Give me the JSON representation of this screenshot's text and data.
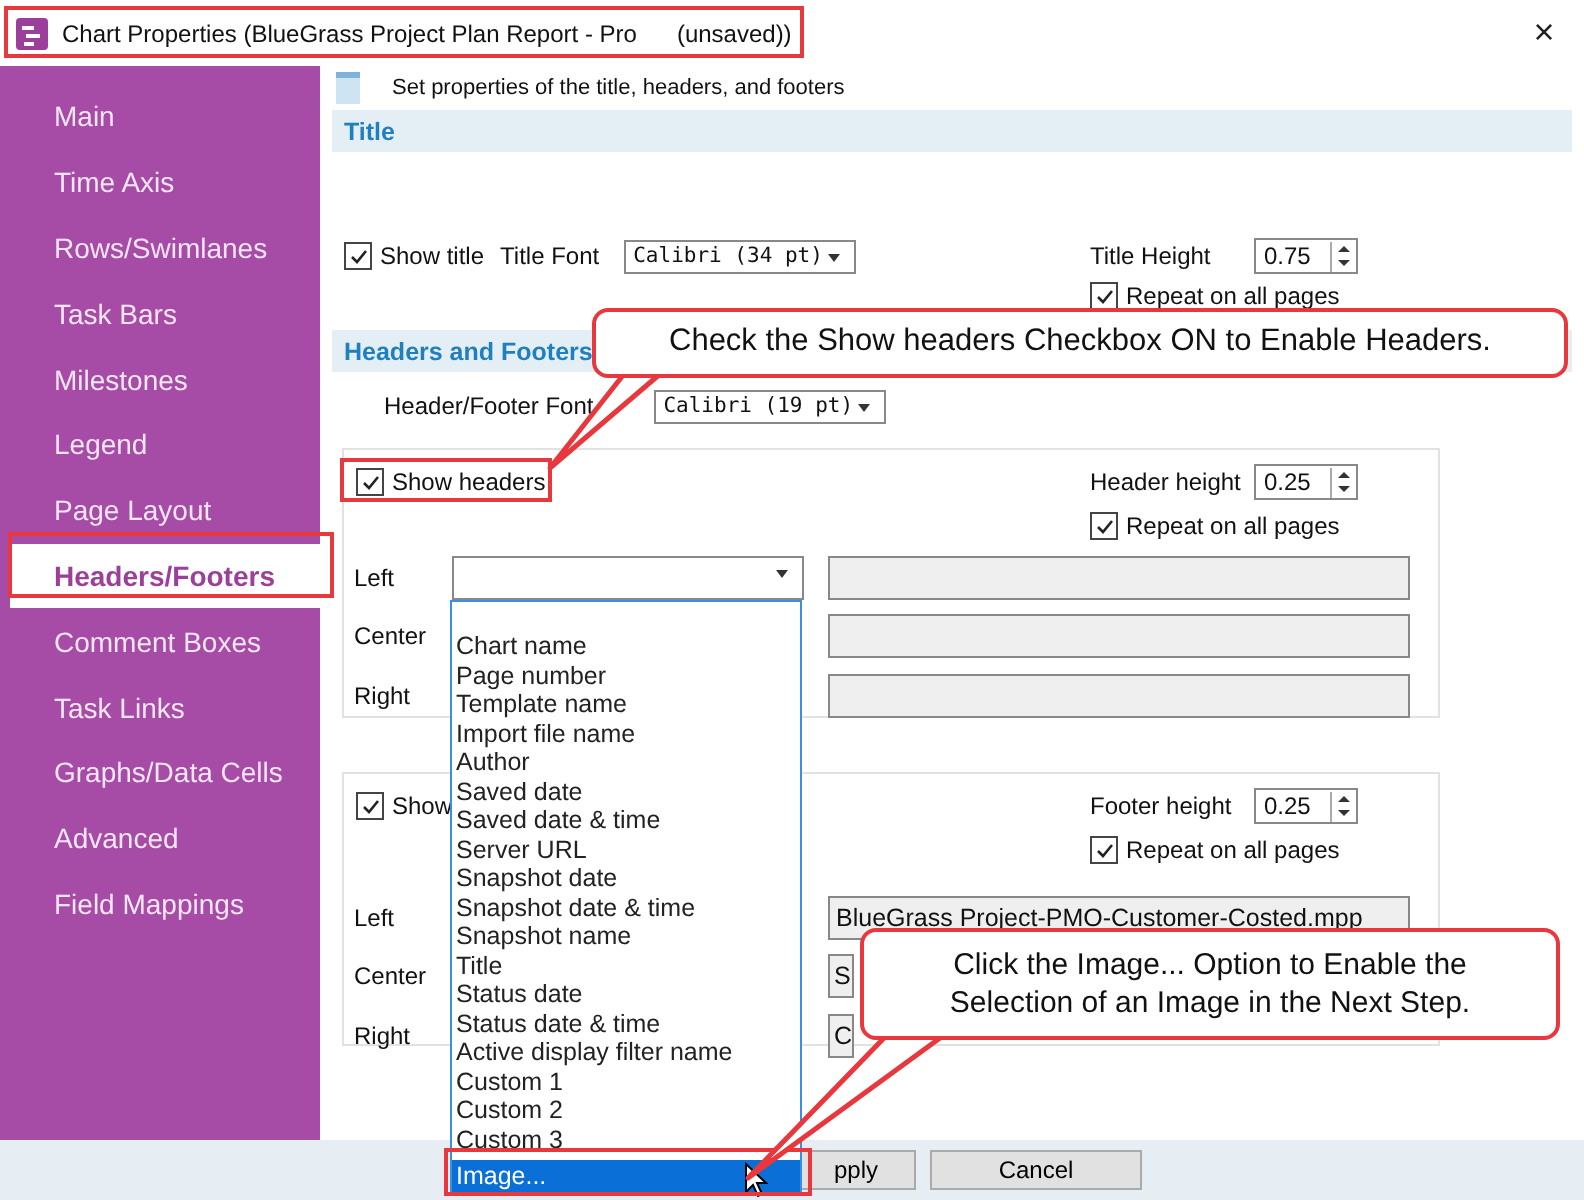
{
  "window": {
    "title": "Chart Properties (BlueGrass Project Plan Report - Pro      (unsaved))",
    "close": "×"
  },
  "sidebar": {
    "items": [
      {
        "label": "Main",
        "selected": false
      },
      {
        "label": "Time Axis",
        "selected": false
      },
      {
        "label": "Rows/Swimlanes",
        "selected": false
      },
      {
        "label": "Task Bars",
        "selected": false
      },
      {
        "label": "Milestones",
        "selected": false
      },
      {
        "label": "Legend",
        "selected": false
      },
      {
        "label": "Page Layout",
        "selected": false
      },
      {
        "label": "Headers/Footers",
        "selected": true
      },
      {
        "label": "Comment Boxes",
        "selected": false
      },
      {
        "label": "Task Links",
        "selected": false
      },
      {
        "label": "Graphs/Data Cells",
        "selected": false
      },
      {
        "label": "Advanced",
        "selected": false
      },
      {
        "label": "Field Mappings",
        "selected": false
      }
    ]
  },
  "page_header": "Set properties of the title, headers, and footers",
  "title_section": {
    "heading": "Title",
    "show_title": {
      "label": "Show title",
      "checked": true
    },
    "font_label": "Title Font",
    "font_value": "Calibri (34 pt)",
    "height_label": "Title Height",
    "height_value": "0.75",
    "repeat": {
      "label": "Repeat on all pages",
      "checked": true
    }
  },
  "headers_footers": {
    "heading": "Headers and Footers",
    "font_label": "Header/Footer Font",
    "font_value": "Calibri (19 pt)",
    "headers": {
      "checkbox": {
        "label": "Show headers",
        "checked": true
      },
      "height_label": "Header height",
      "height_value": "0.25",
      "repeat": {
        "label": "Repeat on all pages",
        "checked": true
      },
      "rows": [
        {
          "label": "Left",
          "dropdown": true,
          "value": ""
        },
        {
          "label": "Center",
          "dropdown": false,
          "value": ""
        },
        {
          "label": "Right",
          "dropdown": false,
          "value": ""
        }
      ]
    },
    "footers": {
      "checkbox": {
        "label": "Show",
        "checked": true
      },
      "height_label": "Footer height",
      "height_value": "0.25",
      "repeat": {
        "label": "Repeat on all pages",
        "checked": true
      },
      "rows": [
        {
          "label": "Left",
          "dropdown": false,
          "value": "BlueGrass Project-PMO-Customer-Costed.mpp"
        },
        {
          "label": "Center",
          "dropdown": false,
          "value": "S"
        },
        {
          "label": "Right",
          "dropdown": false,
          "value": "C"
        }
      ]
    }
  },
  "dropdown_list": {
    "items": [
      {
        "label": "Chart name",
        "selected": false
      },
      {
        "label": "Page number",
        "selected": false
      },
      {
        "label": "Template name",
        "selected": false
      },
      {
        "label": "Import file name",
        "selected": false
      },
      {
        "label": "Author",
        "selected": false
      },
      {
        "label": "Saved date",
        "selected": false
      },
      {
        "label": "Saved date & time",
        "selected": false
      },
      {
        "label": "Server URL",
        "selected": false
      },
      {
        "label": "Snapshot date",
        "selected": false
      },
      {
        "label": "Snapshot date & time",
        "selected": false
      },
      {
        "label": "Snapshot name",
        "selected": false
      },
      {
        "label": "Title",
        "selected": false
      },
      {
        "label": "Status date",
        "selected": false
      },
      {
        "label": "Status date & time",
        "selected": false
      },
      {
        "label": "Active display filter name",
        "selected": false
      },
      {
        "label": "Custom 1",
        "selected": false
      },
      {
        "label": "Custom 2",
        "selected": false
      },
      {
        "label": "Custom 3",
        "selected": false
      },
      {
        "label": "Image...",
        "selected": true
      }
    ]
  },
  "buttons": [
    "pply",
    "Cancel"
  ],
  "callouts": [
    "Check the Show headers Checkbox ON to Enable Headers.",
    "Click the Image... Option to Enable the Selection of an Image in the Next Step."
  ]
}
